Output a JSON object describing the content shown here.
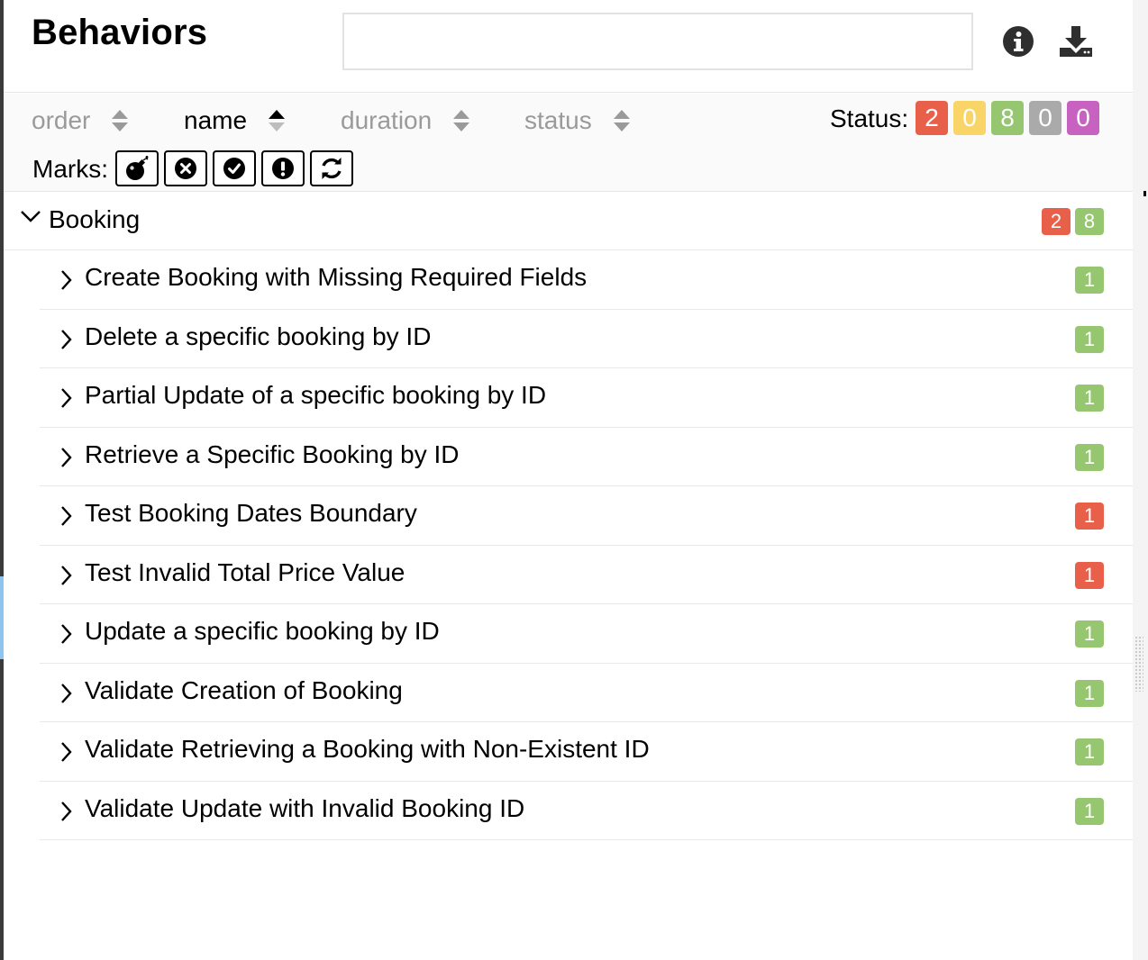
{
  "colors": {
    "failed": "#e9604a",
    "broken": "#f8d566",
    "passed": "#96c66f",
    "skipped": "#aaaaaa",
    "unknown": "#c762c1"
  },
  "header": {
    "title": "Behaviors",
    "search_placeholder": "",
    "info_icon": "info-circle-icon",
    "download_icon": "download-icon"
  },
  "toolbar": {
    "sorters": [
      {
        "label": "order",
        "active": false
      },
      {
        "label": "name",
        "active": true
      },
      {
        "label": "duration",
        "active": false
      },
      {
        "label": "status",
        "active": false
      }
    ],
    "status_label": "Status:",
    "status_counts": [
      {
        "status": "failed",
        "value": "2"
      },
      {
        "status": "broken",
        "value": "0"
      },
      {
        "status": "passed",
        "value": "8"
      },
      {
        "status": "skipped",
        "value": "0"
      },
      {
        "status": "unknown",
        "value": "0"
      }
    ],
    "marks_label": "Marks:",
    "marks": [
      "bomb-icon",
      "times-circle-icon",
      "check-circle-icon",
      "exclamation-circle-icon",
      "refresh-icon"
    ]
  },
  "tree": {
    "group": {
      "name": "Booking",
      "counts": [
        {
          "status": "failed",
          "value": "2"
        },
        {
          "status": "passed",
          "value": "8"
        }
      ]
    },
    "items": [
      {
        "name": "Create Booking with Missing Required Fields",
        "status": "passed",
        "count": "1"
      },
      {
        "name": "Delete a specific booking by ID",
        "status": "passed",
        "count": "1"
      },
      {
        "name": "Partial Update of a specific booking by ID",
        "status": "passed",
        "count": "1"
      },
      {
        "name": "Retrieve a Specific Booking by ID",
        "status": "passed",
        "count": "1"
      },
      {
        "name": "Test Booking Dates Boundary",
        "status": "failed",
        "count": "1"
      },
      {
        "name": "Test Invalid Total Price Value",
        "status": "failed",
        "count": "1"
      },
      {
        "name": "Update a specific booking by ID",
        "status": "passed",
        "count": "1"
      },
      {
        "name": "Validate Creation of Booking",
        "status": "passed",
        "count": "1"
      },
      {
        "name": "Validate Retrieving a Booking with Non-Existent ID",
        "status": "passed",
        "count": "1"
      },
      {
        "name": "Validate Update with Invalid Booking ID",
        "status": "passed",
        "count": "1"
      }
    ]
  }
}
